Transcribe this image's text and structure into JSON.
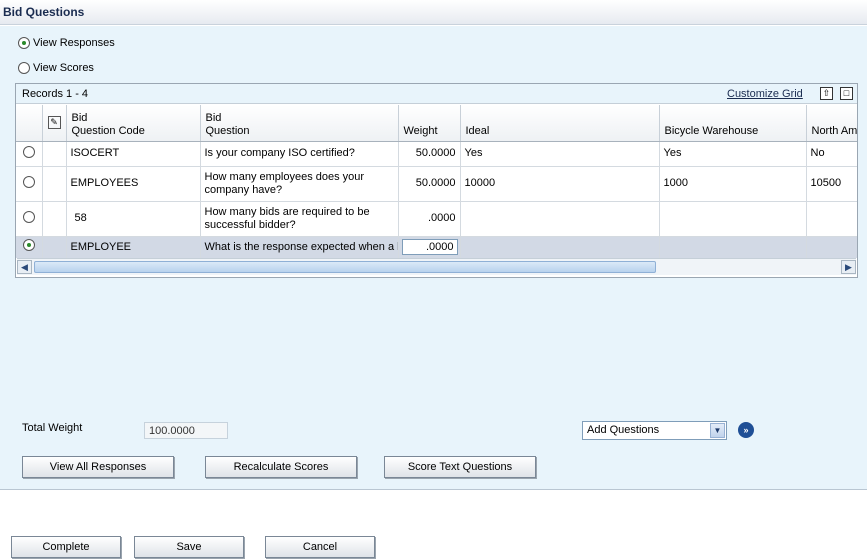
{
  "window": {
    "title": "Bid Questions"
  },
  "view_options": {
    "view_responses": "View Responses",
    "view_scores": "View Scores",
    "selected": "view_responses"
  },
  "grid": {
    "records_label": "Records 1 - 4",
    "customize_label": "Customize Grid",
    "export_icon": "export-icon",
    "maximize_icon": "maximize-icon",
    "columns": {
      "attach": "",
      "code_line1": "Bid",
      "code_line2": "Question Code",
      "question_line1": "Bid",
      "question_line2": "Question",
      "weight": "Weight",
      "ideal": "Ideal",
      "bicycle": "Bicycle Warehouse",
      "north": "North Am"
    },
    "rows": [
      {
        "code": "ISOCERT",
        "question": "Is your company ISO certified?",
        "weight": "50.0000",
        "ideal": "Yes",
        "bicycle": "Yes",
        "north": "No"
      },
      {
        "code": "EMPLOYEES",
        "question": "How many employees does your company have?",
        "weight": "50.0000",
        "ideal": "10000",
        "bicycle": "1000",
        "north": "10500"
      },
      {
        "code": "58",
        "question": "How many bids are required to be successful bidder?",
        "weight": ".0000",
        "ideal": "",
        "bicycle": "",
        "north": ""
      },
      {
        "code": "EMPLOYEE",
        "question": "What is the response expected when a l",
        "weight": ".0000",
        "ideal": "",
        "bicycle": "",
        "north": ""
      }
    ],
    "selected_row": 3
  },
  "totals": {
    "label": "Total Weight",
    "value": "100.0000"
  },
  "add_questions": {
    "selected": "Add Questions"
  },
  "buttons": {
    "view_all": "View All Responses",
    "recalc": "Recalculate Scores",
    "score_text": "Score Text Questions",
    "complete": "Complete",
    "save": "Save",
    "cancel": "Cancel"
  }
}
